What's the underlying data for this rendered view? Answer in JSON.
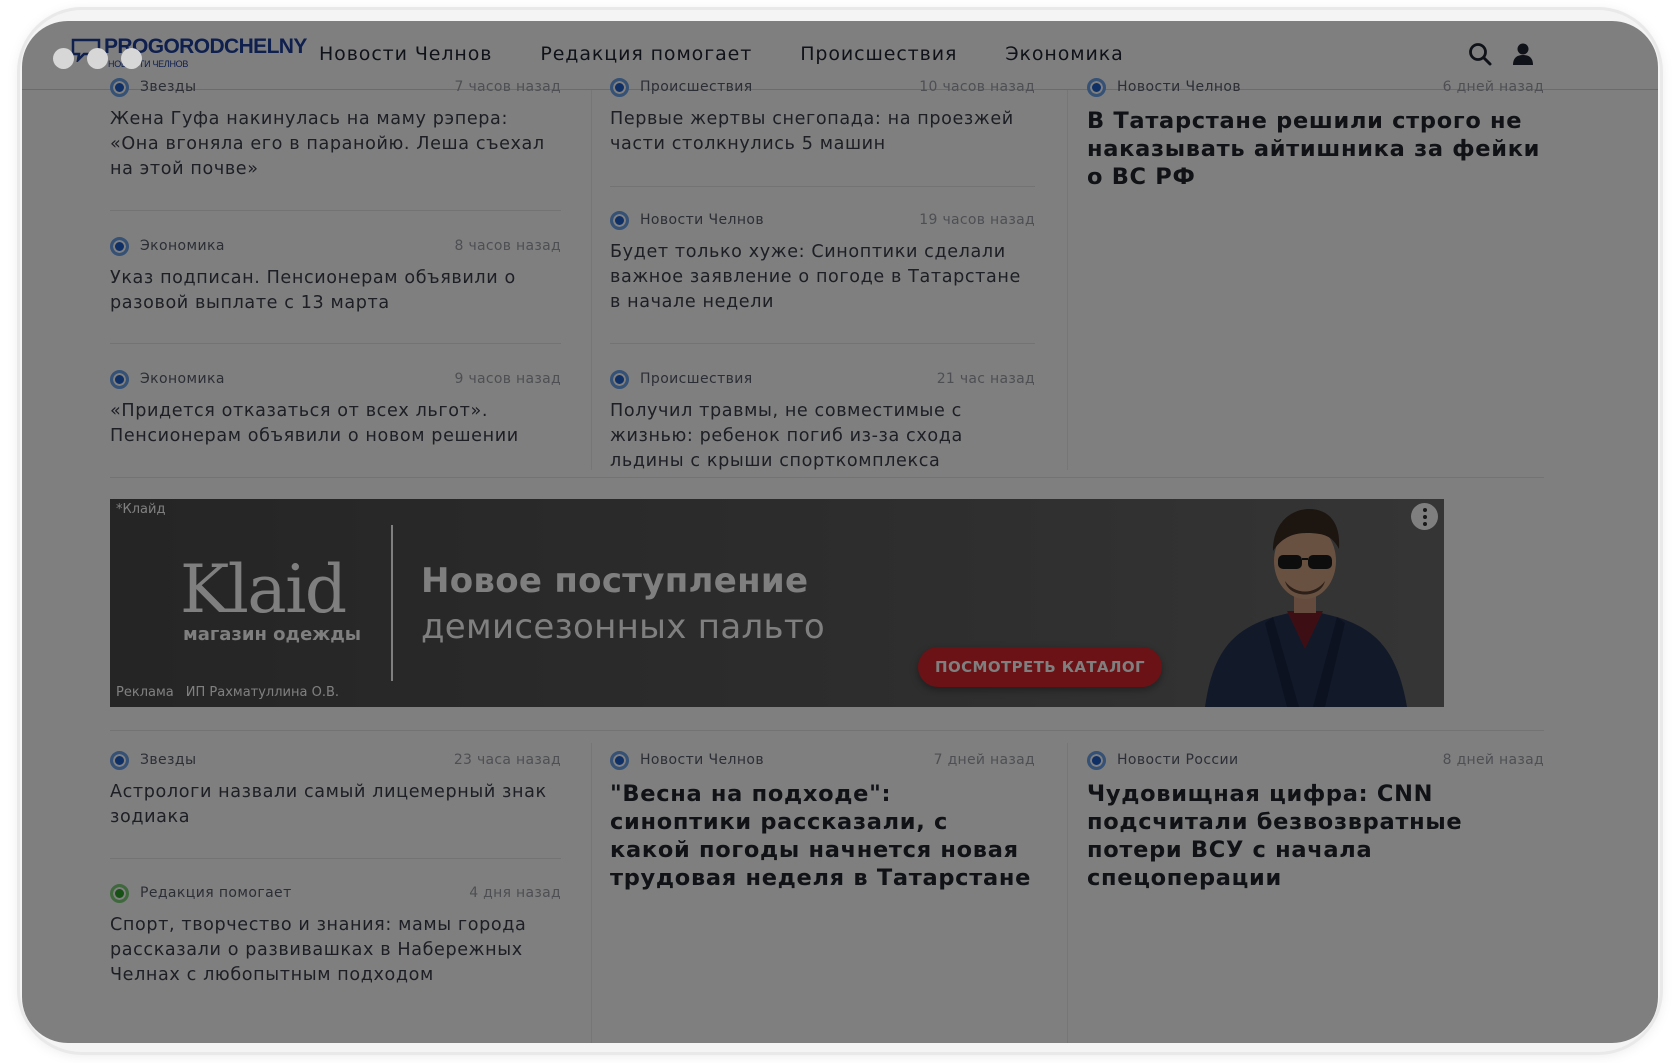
{
  "header": {
    "logo_title": "PROGORODCHELNY",
    "logo_subtitle": "НОВОСТИ ЧЕЛНОВ",
    "nav": [
      "Новости Челнов",
      "Редакция помогает",
      "Происшествия",
      "Экономика"
    ],
    "search_icon": "search-icon",
    "profile_icon": "user-icon"
  },
  "news": {
    "col1": [
      {
        "category": "Звезды",
        "time": "7 часов назад",
        "title": "Жена Гуфа накинулась на маму рэпера: «Она вгоняла его в паранойю. Леша съехал на этой почве»"
      },
      {
        "category": "Экономика",
        "time": "8 часов назад",
        "title": "Указ подписан. Пенсионерам объявили о разовой выплате с 13 марта"
      },
      {
        "category": "Экономика",
        "time": "9 часов назад",
        "title": "«Придется отказаться от всех льгот». Пенсионерам объявили о новом решении"
      }
    ],
    "col2": [
      {
        "category": "Происшествия",
        "time": "10 часов назад",
        "title": "Первые жертвы снегопада: на проезжей части столкнулись 5 машин"
      },
      {
        "category": "Новости Челнов",
        "time": "19 часов назад",
        "title": "Будет только хуже: Синоптики сделали важное заявление о погоде в Татарстане в начале недели"
      },
      {
        "category": "Происшествия",
        "time": "21 час назад",
        "title": "Получил травмы, не совместимые с жизнью: ребенок погиб из-за схода льдины с крыши спорткомплекса"
      }
    ],
    "col3": [
      {
        "category": "Новости Челнов",
        "time": "6 дней назад",
        "title": "В Татарстане решили строго не наказывать айтишника за фейки о ВС РФ"
      }
    ],
    "bottom": [
      {
        "category": "Звезды",
        "time": "23 часа назад",
        "title": "Астрологи назвали самый лицемерный знак зодиака"
      },
      {
        "category": "Редакция помогает",
        "time": "4 дня назад",
        "title": "Спорт, творчество и знания: мамы города рассказали о развивашках в Набережных Челнах с любопытным подходом"
      },
      {
        "category": "Новости Челнов",
        "time": "7 дней назад",
        "title": "\"Весна на подходе\": синоптики рассказали, с какой погоды начнется новая трудовая неделя в Татарстане"
      },
      {
        "category": "Новости России",
        "time": "8 дней назад",
        "title": "Чудовищная цифра: CNN подсчитали безвозвратные потери ВСУ с начала спецоперации"
      }
    ]
  },
  "ad": {
    "flag": "*Клайд",
    "brand": "Klaid",
    "brand_sub": "магазин одежды",
    "headline": "Новое поступление",
    "subheadline": "демисезонных пальто",
    "cta": "ПОСМОТРЕТЬ КАТАЛОГ",
    "label": "Реклама",
    "advertiser": "ИП Рахматуллина О.В."
  },
  "colors": {
    "brand": "#1e3f9c",
    "category_dot": "#1f5fcf",
    "category_dot_help": "#2fa22a",
    "cta": "#d4242a"
  }
}
